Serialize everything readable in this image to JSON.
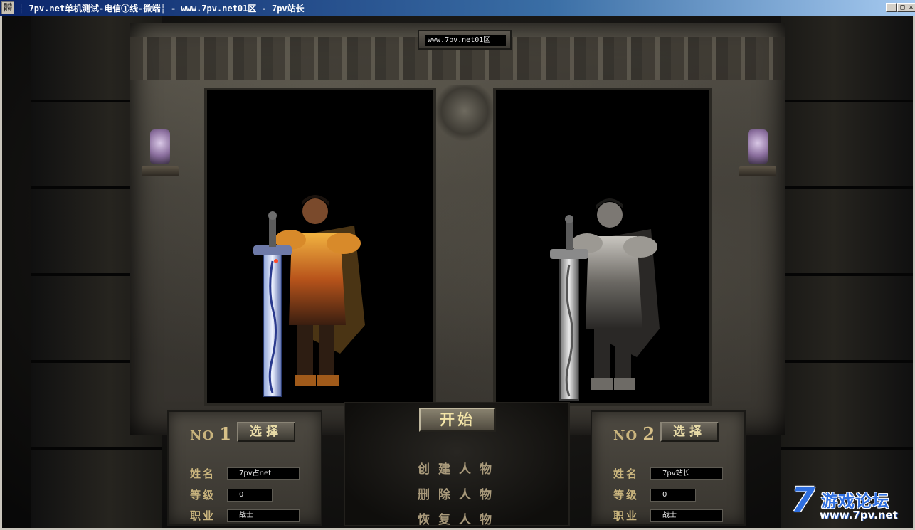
{
  "window": {
    "icon_glyph": "體",
    "title": "7pv.net单机测试-电信①线-微端┊ - www.7pv.net01区 - 7pv站长",
    "title_prefix": "┊",
    "minimize_label": "_",
    "maximize_label": "□",
    "close_label": "×"
  },
  "server_plate": "www.7pv.net01区",
  "slots": [
    {
      "no_label": "NO",
      "no_number": "1",
      "select_label": "选择",
      "name_label": "姓名",
      "name_value": "7pv占net",
      "level_label": "等级",
      "level_value": "0",
      "class_label": "职业",
      "class_value": "战士",
      "selected": true
    },
    {
      "no_label": "NO",
      "no_number": "2",
      "select_label": "选择",
      "name_label": "姓名",
      "name_value": "7pv站长",
      "level_label": "等级",
      "level_value": "0",
      "class_label": "职业",
      "class_value": "战士",
      "selected": false
    }
  ],
  "menu": {
    "start_label": "开始",
    "create_label": "创建人物",
    "delete_label": "删除人物",
    "restore_label": "恢复人物"
  },
  "watermark": {
    "digit": "7",
    "cn": "游戏论坛",
    "url": "www.7pv.net"
  },
  "colors": {
    "title_bar": "#0a246a",
    "gold_text": "#c9b47d",
    "stone": "#3e3b35",
    "watermark_blue": "#2f6fe0"
  }
}
